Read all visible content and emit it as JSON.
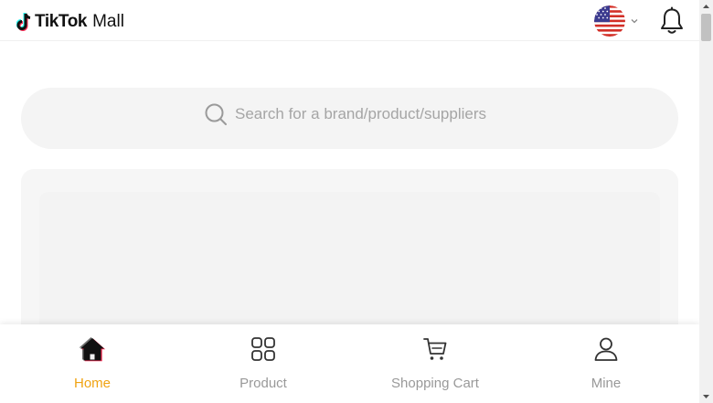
{
  "header": {
    "brand": "TikTok",
    "brand_suffix": "Mall",
    "language_flag": "us-flag-icon",
    "notifications_icon": "bell-icon"
  },
  "search": {
    "placeholder": "Search for a brand/product/suppliers",
    "value": ""
  },
  "tabbar": {
    "active": "home",
    "active_color": "#f0a312",
    "inactive_color": "#999999",
    "items": [
      {
        "key": "home",
        "label": "Home",
        "icon": "home-icon"
      },
      {
        "key": "product",
        "label": "Product",
        "icon": "grid-icon"
      },
      {
        "key": "cart",
        "label": "Shopping Cart",
        "icon": "cart-icon"
      },
      {
        "key": "mine",
        "label": "Mine",
        "icon": "user-icon"
      }
    ]
  }
}
